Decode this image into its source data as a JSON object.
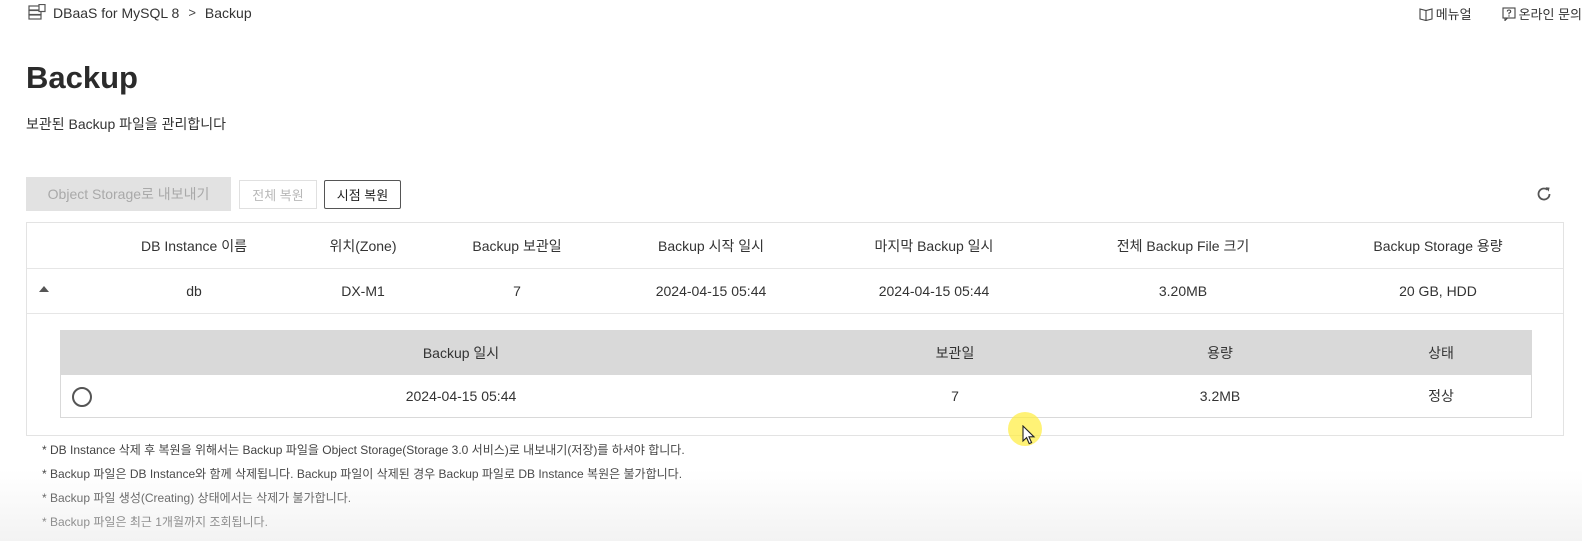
{
  "breadcrumb": {
    "service": "DBaaS for MySQL 8",
    "separator": ">",
    "current": "Backup"
  },
  "toplinks": {
    "manual": "메뉴얼",
    "inquiry": "온라인 문의"
  },
  "page": {
    "title": "Backup",
    "subtitle": "보관된 Backup 파일을 관리합니다"
  },
  "actions": {
    "export": "Object Storage로 내보내기",
    "restore_all": "전체 복원",
    "restore_point": "시점 복원"
  },
  "table": {
    "headers": [
      "DB Instance 이름",
      "위치(Zone)",
      "Backup 보관일",
      "Backup 시작 일시",
      "마지막 Backup 일시",
      "전체 Backup File 크기",
      "Backup Storage 용량"
    ],
    "rows": [
      [
        "db",
        "DX-M1",
        "7",
        "2024-04-15 05:44",
        "2024-04-15 05:44",
        "3.20MB",
        "20 GB, HDD"
      ]
    ]
  },
  "subtable": {
    "headers": [
      "Backup 일시",
      "보관일",
      "용량",
      "상태"
    ],
    "rows": [
      [
        "2024-04-15 05:44",
        "7",
        "3.2MB",
        "정상"
      ]
    ]
  },
  "notes": [
    "* DB Instance 삭제 후 복원을 위해서는 Backup 파일을 Object Storage(Storage 3.0 서비스)로 내보내기(저장)를 하셔야 합니다.",
    "* Backup 파일은 DB Instance와 함께 삭제됩니다. Backup 파일이 삭제된 경우 Backup 파일로 DB Instance 복원은 불가합니다.",
    "* Backup 파일 생성(Creating) 상태에서는 삭제가 불가합니다.",
    "* Backup 파일은 최근 1개월까지 조회됩니다."
  ]
}
